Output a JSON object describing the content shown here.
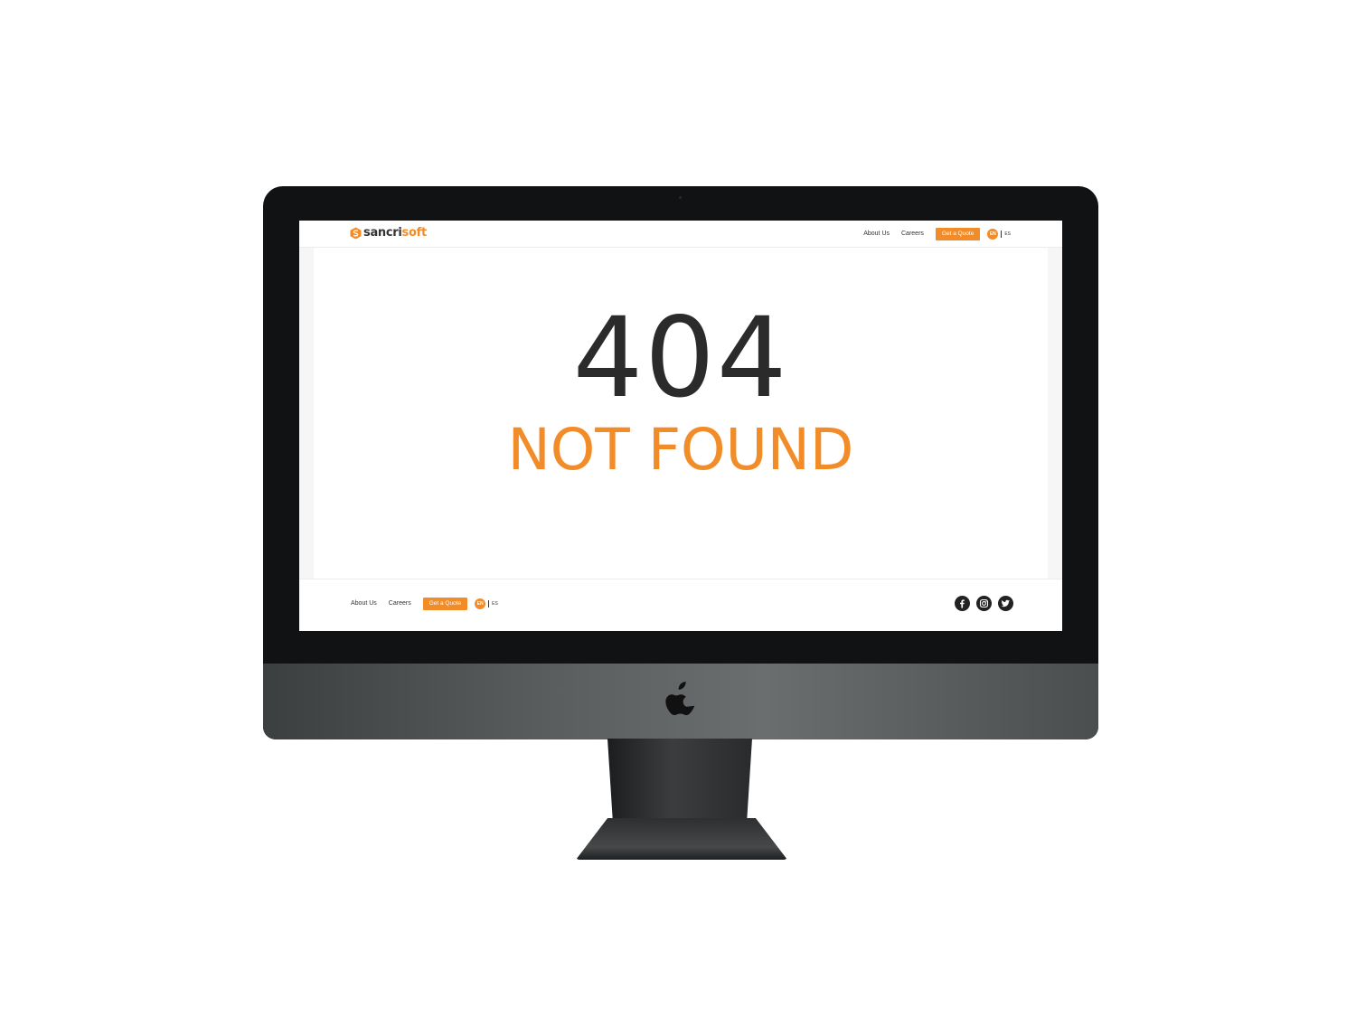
{
  "brand": {
    "logo_part1": "sancri",
    "logo_part2": "soft",
    "accent_color": "#f28c28",
    "text_color": "#333333"
  },
  "header": {
    "nav": [
      {
        "label": "About Us"
      },
      {
        "label": "Careers"
      }
    ],
    "quote_button": "Get a Quote",
    "lang_current": "EN",
    "lang_alt": "ES"
  },
  "main": {
    "error_code": "404",
    "error_message": "NOT FOUND"
  },
  "footer": {
    "nav": [
      {
        "label": "About Us"
      },
      {
        "label": "Careers"
      }
    ],
    "quote_button": "Get a Quote",
    "lang_current": "EN",
    "lang_alt": "ES",
    "social": [
      {
        "icon": "facebook-icon"
      },
      {
        "icon": "instagram-icon"
      },
      {
        "icon": "twitter-icon"
      }
    ]
  },
  "device": {
    "type": "desktop-monitor",
    "logo_icon": "apple-logo-icon"
  }
}
